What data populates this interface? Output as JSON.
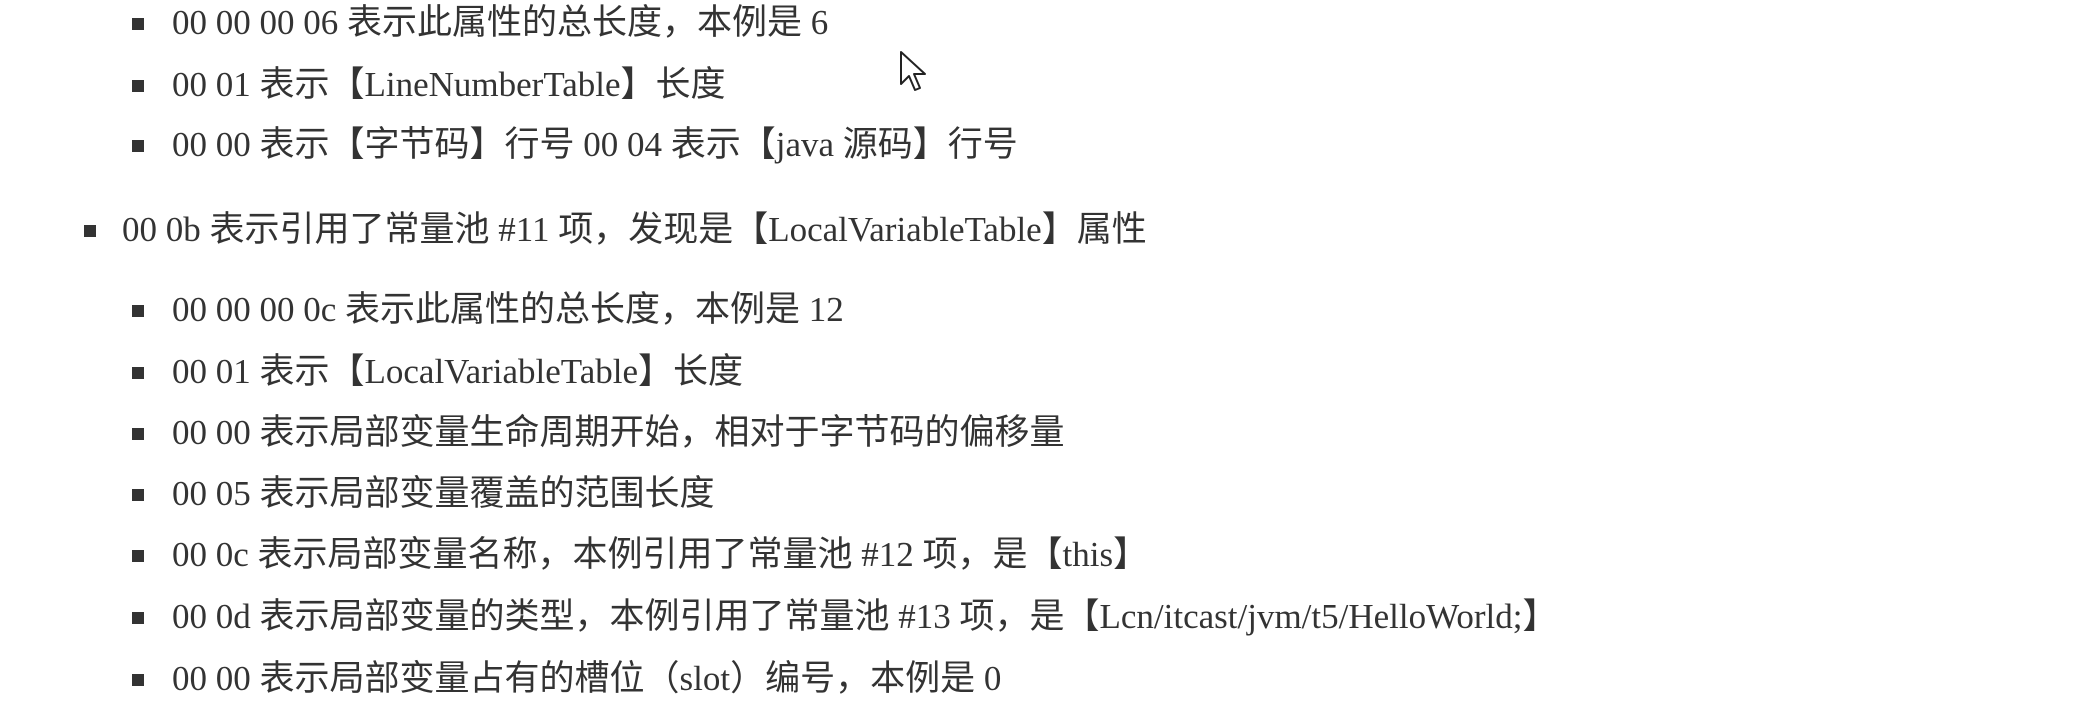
{
  "list": {
    "group1_subitems": [
      "00 00 00 06 表示此属性的总长度，本例是 6",
      "00 01 表示【LineNumberTable】长度",
      "00 00 表示【字节码】行号 00 04 表示【java 源码】行号"
    ],
    "top_item": "00 0b 表示引用了常量池 #11 项，发现是【LocalVariableTable】属性",
    "group2_subitems": [
      "00 00 00 0c 表示此属性的总长度，本例是 12",
      "00 01 表示【LocalVariableTable】长度",
      "00 00 表示局部变量生命周期开始，相对于字节码的偏移量",
      "00 05 表示局部变量覆盖的范围长度",
      "00 0c 表示局部变量名称，本例引用了常量池 #12 项，是【this】",
      "00 0d 表示局部变量的类型，本例引用了常量池 #13 项，是【Lcn/itcast/jvm/t5/HelloWorld;】",
      "00 00 表示局部变量占有的槽位（slot）编号，本例是 0"
    ]
  },
  "icons": {
    "bullet": "square-bullet-icon",
    "cursor": "mouse-pointer-icon"
  },
  "colors": {
    "text": "#333333",
    "background": "#ffffff"
  }
}
